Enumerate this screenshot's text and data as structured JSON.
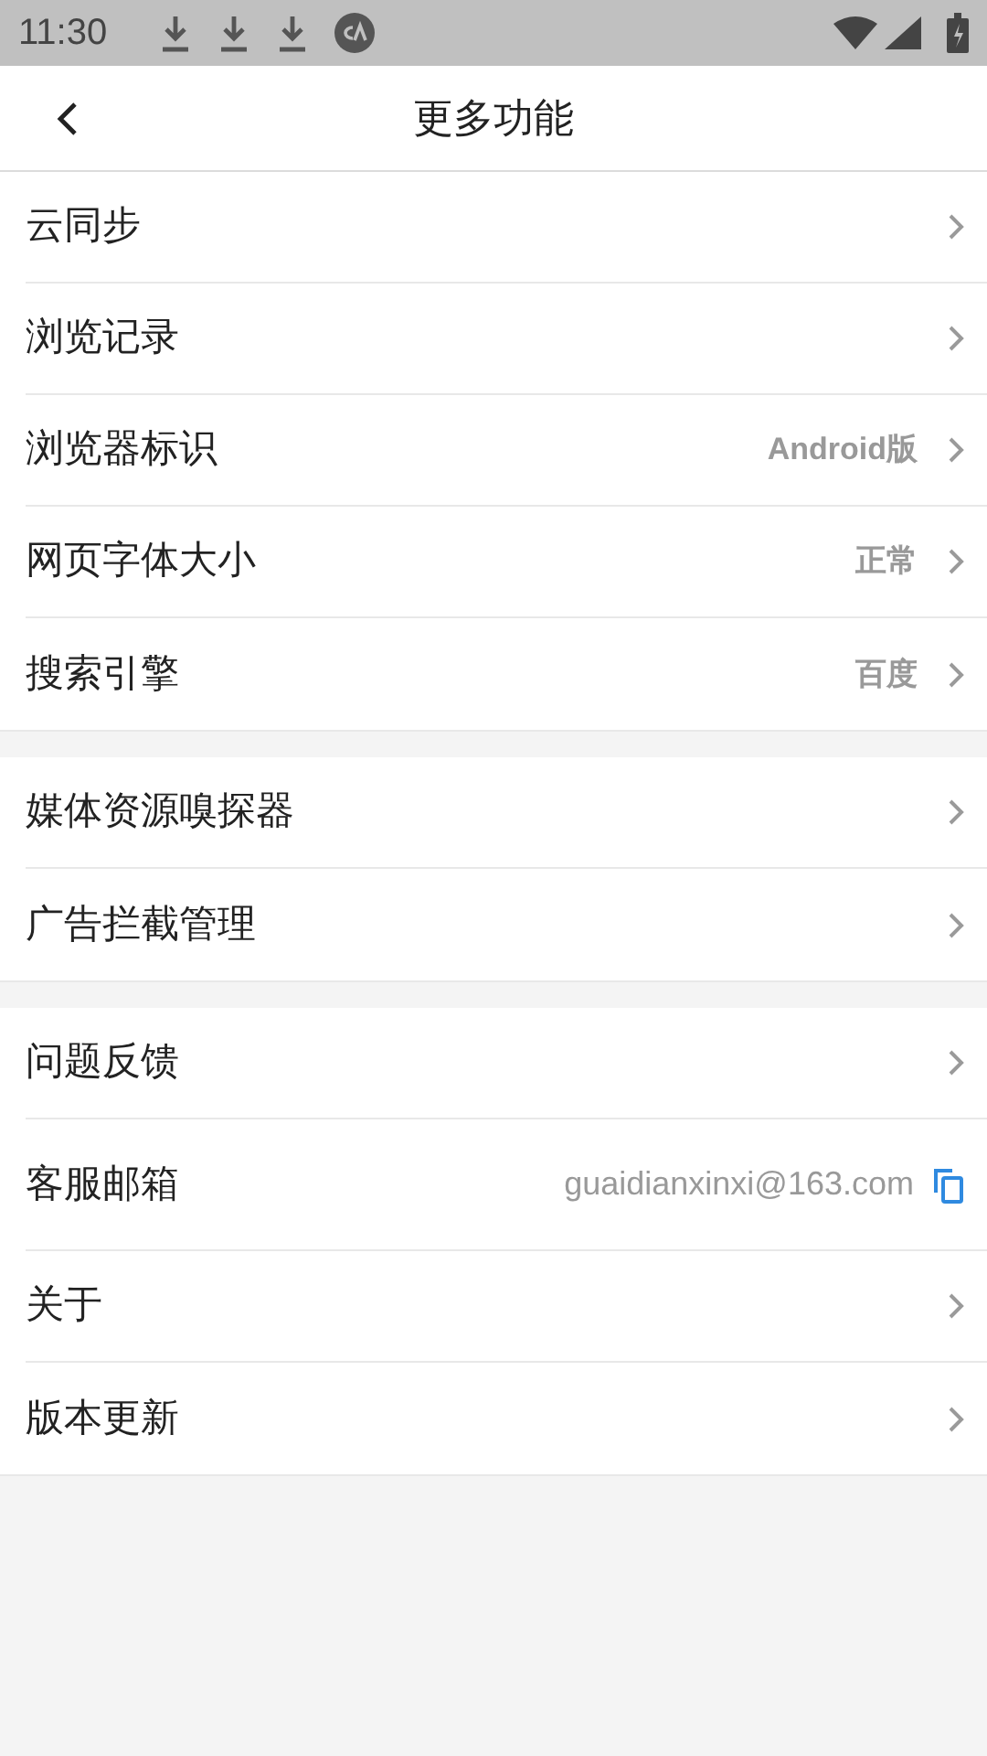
{
  "status_bar": {
    "time": "11:30"
  },
  "header": {
    "title": "更多功能"
  },
  "groups": [
    {
      "items": [
        {
          "label": "云同步",
          "kind": "link"
        },
        {
          "label": "浏览记录",
          "kind": "link"
        },
        {
          "label": "浏览器标识",
          "value": "Android版",
          "kind": "link"
        },
        {
          "label": "网页字体大小",
          "value": "正常",
          "kind": "link"
        },
        {
          "label": "搜索引擎",
          "value": "百度",
          "kind": "link"
        }
      ]
    },
    {
      "items": [
        {
          "label": "媒体资源嗅探器",
          "kind": "link"
        },
        {
          "label": "广告拦截管理",
          "kind": "link"
        }
      ]
    },
    {
      "items": [
        {
          "label": "问题反馈",
          "kind": "link"
        },
        {
          "label": "客服邮箱",
          "value": "guaidianxinxi@163.com",
          "kind": "copy"
        },
        {
          "label": "关于",
          "kind": "link"
        },
        {
          "label": "版本更新",
          "kind": "link"
        }
      ]
    }
  ]
}
